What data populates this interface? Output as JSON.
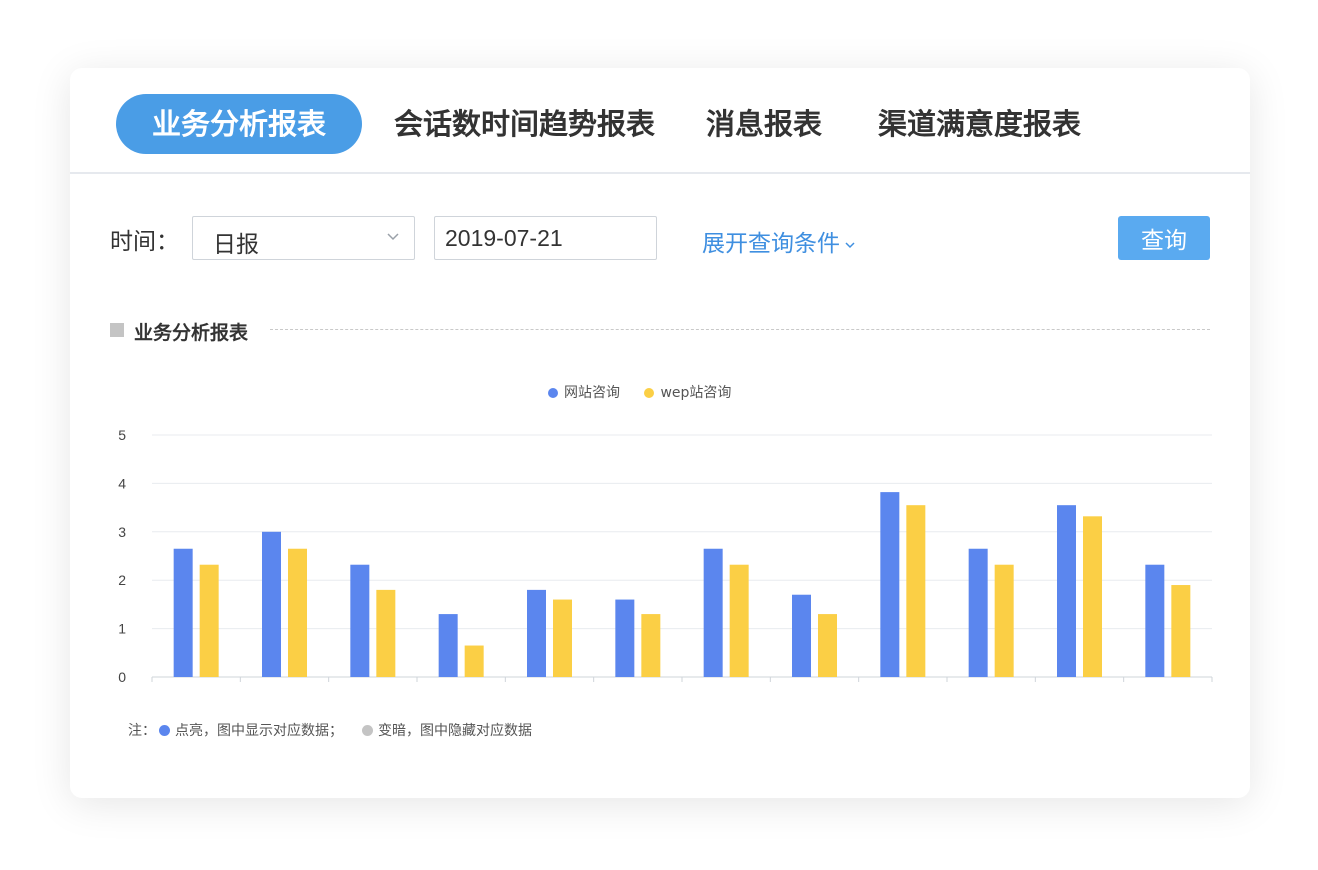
{
  "tabs": [
    {
      "label": "业务分析报表",
      "active": true
    },
    {
      "label": "会话数时间趋势报表",
      "active": false
    },
    {
      "label": "消息报表",
      "active": false
    },
    {
      "label": "渠道满意度报表",
      "active": false
    }
  ],
  "filter": {
    "time_label": "时间：",
    "period_value": "日报",
    "date_value": "2019-07-21",
    "expand_label": "展开查询条件",
    "query_label": "查询"
  },
  "section": {
    "title": "业务分析报表"
  },
  "colors": {
    "primary": "#4a9de6",
    "series1": "#5b86ee",
    "series2": "#fbcf45",
    "muted": "#c4c4c4"
  },
  "chart_data": {
    "type": "bar",
    "categories": [
      "",
      "",
      "",
      "",
      "",
      "",
      "",
      "",
      "",
      "",
      "",
      ""
    ],
    "series": [
      {
        "name": "网站咨询",
        "color": "#5b86ee",
        "values": [
          2.65,
          3.0,
          2.32,
          1.3,
          1.8,
          1.6,
          2.65,
          1.7,
          3.82,
          2.65,
          3.55,
          2.32
        ]
      },
      {
        "name": "wep站咨询",
        "color": "#fbcf45",
        "values": [
          2.32,
          2.65,
          1.8,
          0.65,
          1.6,
          1.3,
          2.32,
          1.3,
          3.55,
          2.32,
          3.32,
          1.9
        ]
      }
    ],
    "yticks": [
      "0",
      "1",
      "2",
      "3",
      "4",
      "5"
    ],
    "ylim": [
      0,
      5
    ],
    "grid": true,
    "legend": "top-center"
  },
  "note": {
    "prefix": "注：",
    "lit_text": "点亮，图中显示对应数据；",
    "dim_text": "变暗，图中隐藏对应数据"
  }
}
